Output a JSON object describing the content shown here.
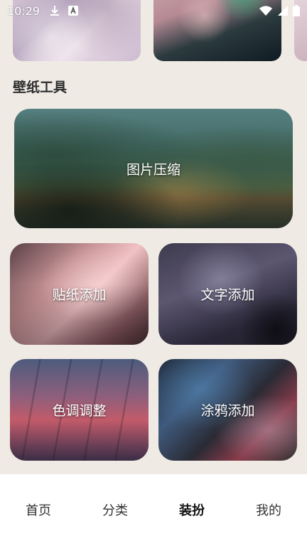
{
  "status_bar": {
    "time": "10:29",
    "icons": [
      "download-icon",
      "a-icon",
      "wifi-icon",
      "signal-icon",
      "battery-icon"
    ]
  },
  "section": {
    "title": "壁纸工具"
  },
  "tools": [
    {
      "label": "图片压缩"
    },
    {
      "label": "贴纸添加"
    },
    {
      "label": "文字添加"
    },
    {
      "label": "色调调整"
    },
    {
      "label": "涂鸦添加"
    }
  ],
  "bottom_nav": {
    "items": [
      {
        "label": "首页"
      },
      {
        "label": "分类"
      },
      {
        "label": "装扮"
      },
      {
        "label": "我的"
      }
    ],
    "active": "装扮"
  },
  "colors": {
    "background": "#efebe4",
    "nav_background": "#ffffff",
    "text": "#2e2e2e"
  }
}
